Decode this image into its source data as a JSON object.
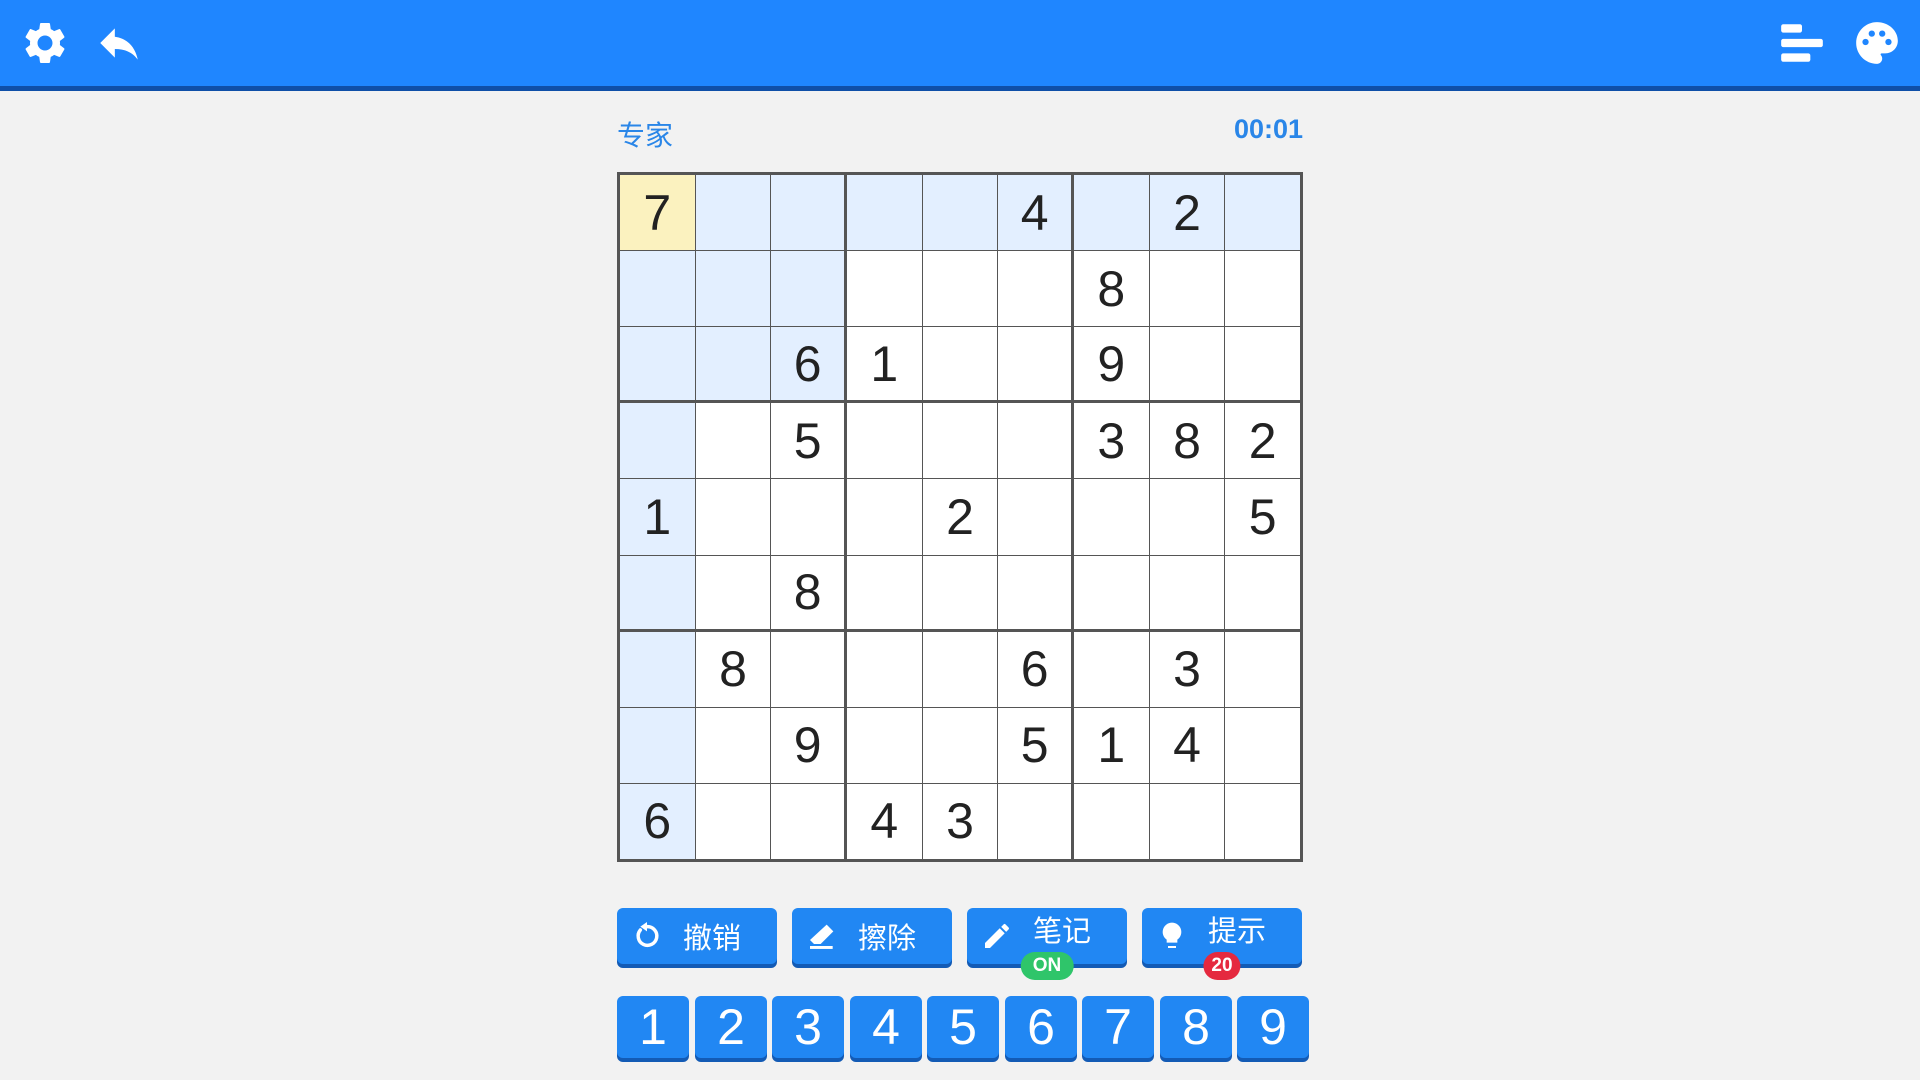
{
  "topbar": {
    "left_icons": [
      "gear-icon",
      "undo-arrow-icon"
    ],
    "right_icons": [
      "stats-bars-icon",
      "palette-icon"
    ],
    "color": "#1f86ff"
  },
  "header": {
    "difficulty": "专家",
    "timer": "00:01"
  },
  "board": {
    "selected": [
      0,
      0
    ],
    "cells": [
      [
        "7",
        "",
        "",
        "",
        "",
        "4",
        "",
        "2",
        ""
      ],
      [
        "",
        "",
        "",
        "",
        "",
        "",
        "8",
        "",
        ""
      ],
      [
        "",
        "",
        "6",
        "1",
        "",
        "",
        "9",
        "",
        ""
      ],
      [
        "",
        "",
        "5",
        "",
        "",
        "",
        "3",
        "8",
        "2"
      ],
      [
        "1",
        "",
        "",
        "",
        "2",
        "",
        "",
        "",
        "5"
      ],
      [
        "",
        "",
        "8",
        "",
        "",
        "",
        "",
        "",
        ""
      ],
      [
        "",
        "8",
        "",
        "",
        "",
        "6",
        "",
        "3",
        ""
      ],
      [
        "",
        "",
        "9",
        "",
        "",
        "5",
        "1",
        "4",
        ""
      ],
      [
        "6",
        "",
        "",
        "4",
        "3",
        "",
        "",
        "",
        ""
      ]
    ],
    "highlight_color": "#e3efff",
    "selected_color": "#fbf2bf"
  },
  "actions": [
    {
      "label": "撤销",
      "icon": "undo-rotate-icon"
    },
    {
      "label": "擦除",
      "icon": "eraser-icon"
    },
    {
      "label": "笔记",
      "icon": "pencil-icon",
      "badge": "ON"
    },
    {
      "label": "提示",
      "icon": "lightbulb-icon",
      "badge": "20"
    }
  ],
  "numpad": [
    "1",
    "2",
    "3",
    "4",
    "5",
    "6",
    "7",
    "8",
    "9"
  ]
}
